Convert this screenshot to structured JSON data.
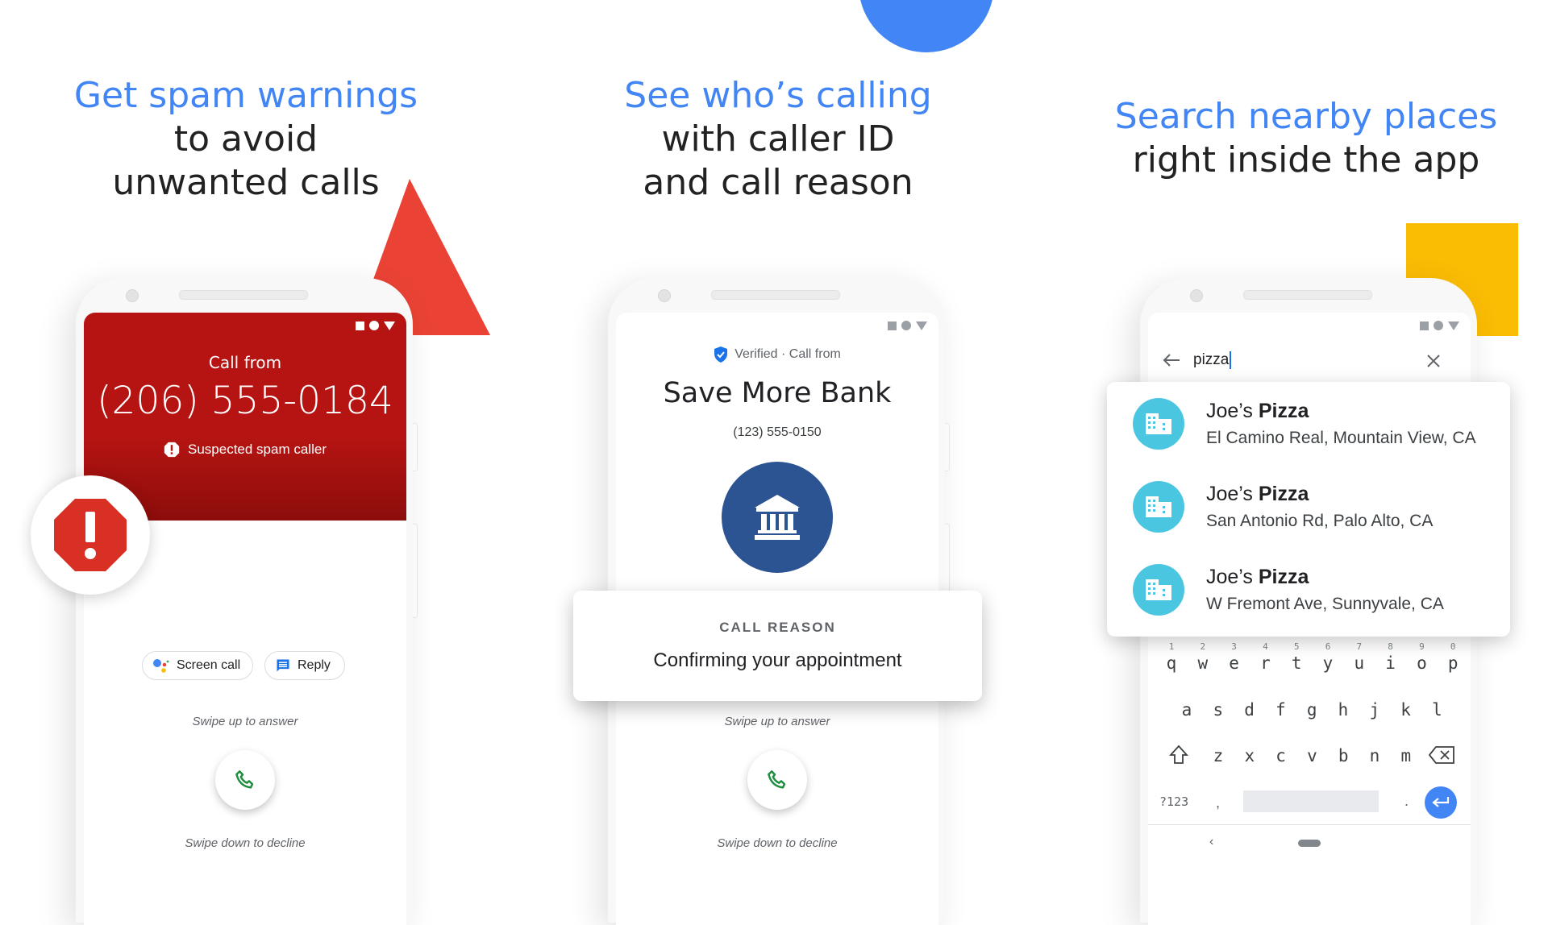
{
  "colors": {
    "brand_blue": "#4285f4",
    "spam_red": "#b51412",
    "stop_red": "#d93025",
    "triangle_red": "#ea4335",
    "yellow": "#fbbc04",
    "bank_blue": "#2c5492",
    "place_cyan": "#4ac6e0",
    "answer_green": "#1e8e3e"
  },
  "panels": [
    {
      "headline_blue": "Get spam warnings",
      "headline_rest_line1": "to avoid",
      "headline_rest_line2": "unwanted calls",
      "call_from": "Call from",
      "phone_number": "(206) 555-0184",
      "spam_label": "Suspected spam caller",
      "screen_call_label": "Screen call",
      "reply_label": "Reply",
      "swipe_up": "Swipe up to answer",
      "swipe_down": "Swipe down to decline",
      "icons": [
        "warning-octagon-icon",
        "assistant-icon",
        "message-icon",
        "phone-icon"
      ]
    },
    {
      "headline_blue": "See who’s calling",
      "headline_rest_line1": "with caller ID",
      "headline_rest_line2": "and call reason",
      "verified_label": "Verified · Call from",
      "caller_name": "Save More Bank",
      "phone_number": "(123) 555-0150",
      "reason_title": "CALL REASON",
      "reason_text": "Confirming your appointment",
      "swipe_up": "Swipe up to answer",
      "swipe_down": "Swipe down to decline",
      "icons": [
        "verified-shield-icon",
        "bank-icon",
        "phone-icon"
      ]
    },
    {
      "headline_blue": "Search nearby places",
      "headline_rest_line1": "right inside the app",
      "search_query": "pizza",
      "results": [
        {
          "name_plain": "Joe’s ",
          "name_bold": "Pizza",
          "address": "El Camino Real, Mountain View, CA"
        },
        {
          "name_plain": "Joe’s ",
          "name_bold": "Pizza",
          "address": "San Antonio Rd, Palo Alto, CA"
        },
        {
          "name_plain": "Joe’s ",
          "name_bold": "Pizza",
          "address": "W Fremont Ave, Sunnyvale, CA"
        }
      ],
      "keyboard": {
        "row1": [
          "q",
          "w",
          "e",
          "r",
          "t",
          "y",
          "u",
          "i",
          "o",
          "p"
        ],
        "row1_nums": [
          "1",
          "2",
          "3",
          "4",
          "5",
          "6",
          "7",
          "8",
          "9",
          "0"
        ],
        "row2": [
          "a",
          "s",
          "d",
          "f",
          "g",
          "h",
          "j",
          "k",
          "l"
        ],
        "row3": [
          "z",
          "x",
          "c",
          "v",
          "b",
          "n",
          "m"
        ],
        "symbols_key": "?123",
        "comma_key": ",",
        "period_key": "."
      },
      "icons": [
        "back-arrow-icon",
        "close-icon",
        "building-icon",
        "shift-icon",
        "backspace-icon",
        "enter-icon"
      ]
    }
  ]
}
